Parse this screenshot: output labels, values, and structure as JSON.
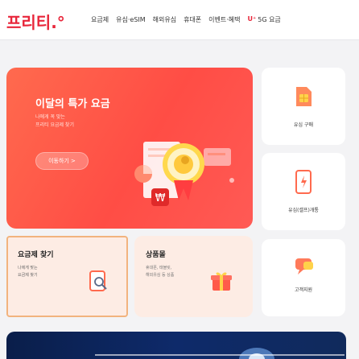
{
  "header": {
    "logo": "프리티.°",
    "nav": [
      "요금제",
      "유심·eSIM",
      "해외유심",
      "휴대폰",
      "이벤트·혜택"
    ],
    "uplus": "U⁺",
    "uplus_label": "5G 요금"
  },
  "hero": {
    "title": "이달의 특가 요금",
    "subtitle_lines": [
      "나에게 꼭 맞는",
      "프리티 요금제 찾기"
    ],
    "button_label": "이동하기 >"
  },
  "side_cards": [
    {
      "label": "유심 구매",
      "icon": "sim-card-icon"
    },
    {
      "label": "유심(셀프)개통",
      "icon": "phone-activation-icon"
    },
    {
      "label": "고객지원",
      "icon": "customer-support-icon"
    }
  ],
  "find_plan": {
    "title": "요금제 찾기",
    "desc_lines": [
      "나에게 맞는",
      "요금제 찾기"
    ]
  },
  "plan_card": {
    "title": "상품몰",
    "desc_lines": [
      "휴대폰, 태블릿,",
      "해외유심 등 상품"
    ]
  },
  "colors": {
    "brand": "#e8263a",
    "hero_bg": "#ff5a4a",
    "card_peach": "#fdece4",
    "find_border": "#f2b37e"
  }
}
